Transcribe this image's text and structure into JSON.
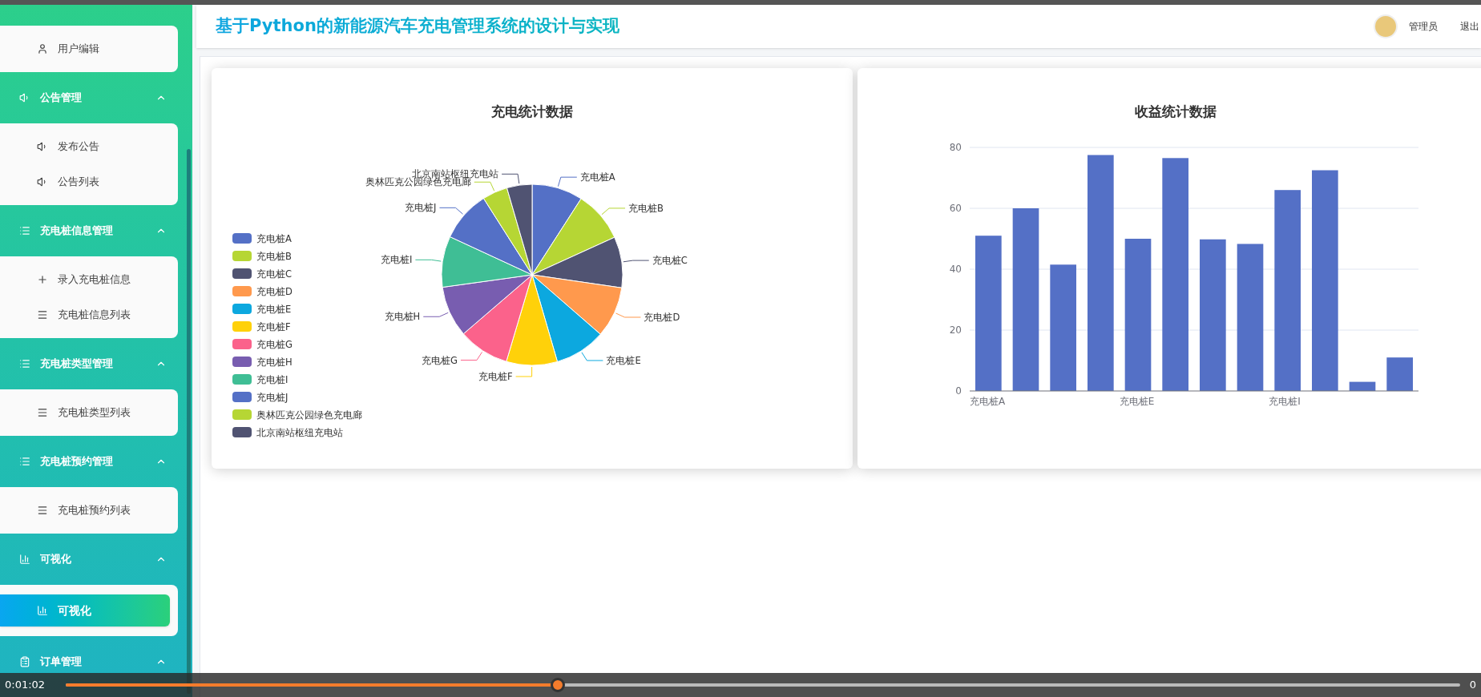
{
  "sidebar": {
    "groups": [
      {
        "items": [
          {
            "label": "用户编辑",
            "kind": "user",
            "selected": false
          }
        ]
      },
      {
        "title": "公告管理",
        "kind": "notice",
        "expanded": true,
        "items": [
          {
            "label": "发布公告",
            "kind": "notice",
            "selected": false
          },
          {
            "label": "公告列表",
            "kind": "notice",
            "selected": false
          }
        ]
      },
      {
        "title": "充电桩信息管理",
        "kind": "list",
        "expanded": true,
        "items": [
          {
            "label": "录入充电桩信息",
            "kind": "add",
            "selected": false
          },
          {
            "label": "充电桩信息列表",
            "kind": "list",
            "selected": false
          }
        ]
      },
      {
        "title": "充电桩类型管理",
        "kind": "list",
        "expanded": true,
        "items": [
          {
            "label": "充电桩类型列表",
            "kind": "list",
            "selected": false
          }
        ]
      },
      {
        "title": "充电桩预约管理",
        "kind": "list",
        "expanded": true,
        "items": [
          {
            "label": "充电桩预约列表",
            "kind": "list",
            "selected": false
          }
        ]
      },
      {
        "title": "可视化",
        "kind": "chart",
        "expanded": true,
        "items": [
          {
            "label": "可视化",
            "kind": "chart",
            "selected": true
          }
        ]
      },
      {
        "title": "订单管理",
        "kind": "order",
        "expanded": true
      }
    ]
  },
  "header": {
    "title": "基于Python的新能源汽车充电管理系统的设计与实现",
    "user": "管理员",
    "logout": "退出"
  },
  "pie_card": {
    "title": "充电统计数据",
    "legend": [
      {
        "label": "充电桩A",
        "color": "#5470c6"
      },
      {
        "label": "充电桩B",
        "color": "#b6d634"
      },
      {
        "label": "充电桩C",
        "color": "#505372"
      },
      {
        "label": "充电桩D",
        "color": "#ff994d"
      },
      {
        "label": "充电桩E",
        "color": "#0ca8df"
      },
      {
        "label": "充电桩F",
        "color": "#ffd10a"
      },
      {
        "label": "充电桩G",
        "color": "#fb628b"
      },
      {
        "label": "充电桩H",
        "color": "#785db0"
      },
      {
        "label": "充电桩I",
        "color": "#3fbe95"
      },
      {
        "label": "充电桩J",
        "color": "#5470c6"
      },
      {
        "label": "奥林匹克公园绿色充电廊",
        "color": "#b6d634"
      },
      {
        "label": "北京南站枢纽充电站",
        "color": "#505372"
      }
    ],
    "chart_data": {
      "type": "pie",
      "categories": [
        "充电桩A",
        "充电桩B",
        "充电桩C",
        "充电桩D",
        "充电桩E",
        "充电桩F",
        "充电桩G",
        "充电桩H",
        "充电桩I",
        "充电桩J",
        "奥林匹克公园绿色充电廊",
        "北京南站枢纽充电站"
      ],
      "series": [
        {
          "values": [
            9.1,
            9.1,
            9.1,
            9.1,
            9.1,
            9.1,
            9.1,
            9.1,
            9.1,
            9.1,
            4.5,
            4.5
          ]
        }
      ]
    }
  },
  "bar_card": {
    "title": "收益统计数据",
    "chart_data": {
      "type": "bar",
      "ylim": [
        0,
        80
      ],
      "yticks": [
        0,
        20,
        40,
        60,
        80
      ],
      "grid": true,
      "categories": [
        "充电桩A",
        null,
        null,
        null,
        "充电桩E",
        null,
        null,
        null,
        "充电桩I",
        null,
        null,
        null
      ],
      "series": [
        {
          "color": "#5470c6",
          "values": [
            51,
            60,
            41.5,
            77.5,
            50,
            76.5,
            49.8,
            48.3,
            66,
            72.5,
            3,
            11
          ]
        }
      ]
    }
  },
  "player": {
    "time": "0:01:02",
    "level": 0.353,
    "end_time": "0"
  }
}
